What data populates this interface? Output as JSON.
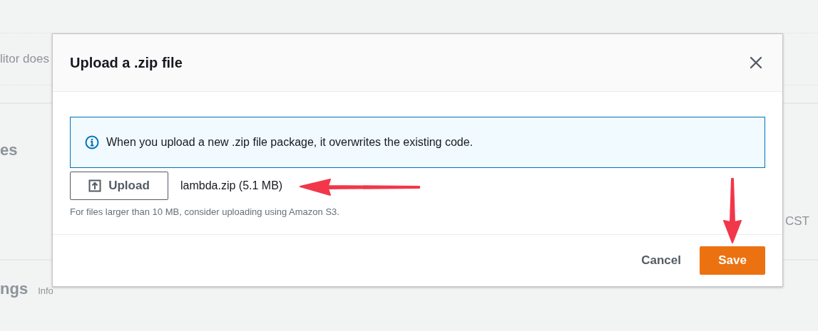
{
  "background": {
    "editor_note": "litor does",
    "section_title": "es",
    "time_zone": "CST",
    "settings_title": "ngs",
    "settings_info": "Info"
  },
  "dialog": {
    "title": "Upload a .zip file",
    "alert": "When you upload a new .zip file package, it overwrites the existing code.",
    "upload_button": "Upload",
    "file_name": "lambda.zip (5.1 MB)",
    "hint": "For files larger than 10 MB, consider uploading using Amazon S3.",
    "buttons": [
      {
        "kind": "link",
        "label": "Cancel"
      },
      {
        "kind": "primary",
        "label": "Save"
      }
    ]
  }
}
